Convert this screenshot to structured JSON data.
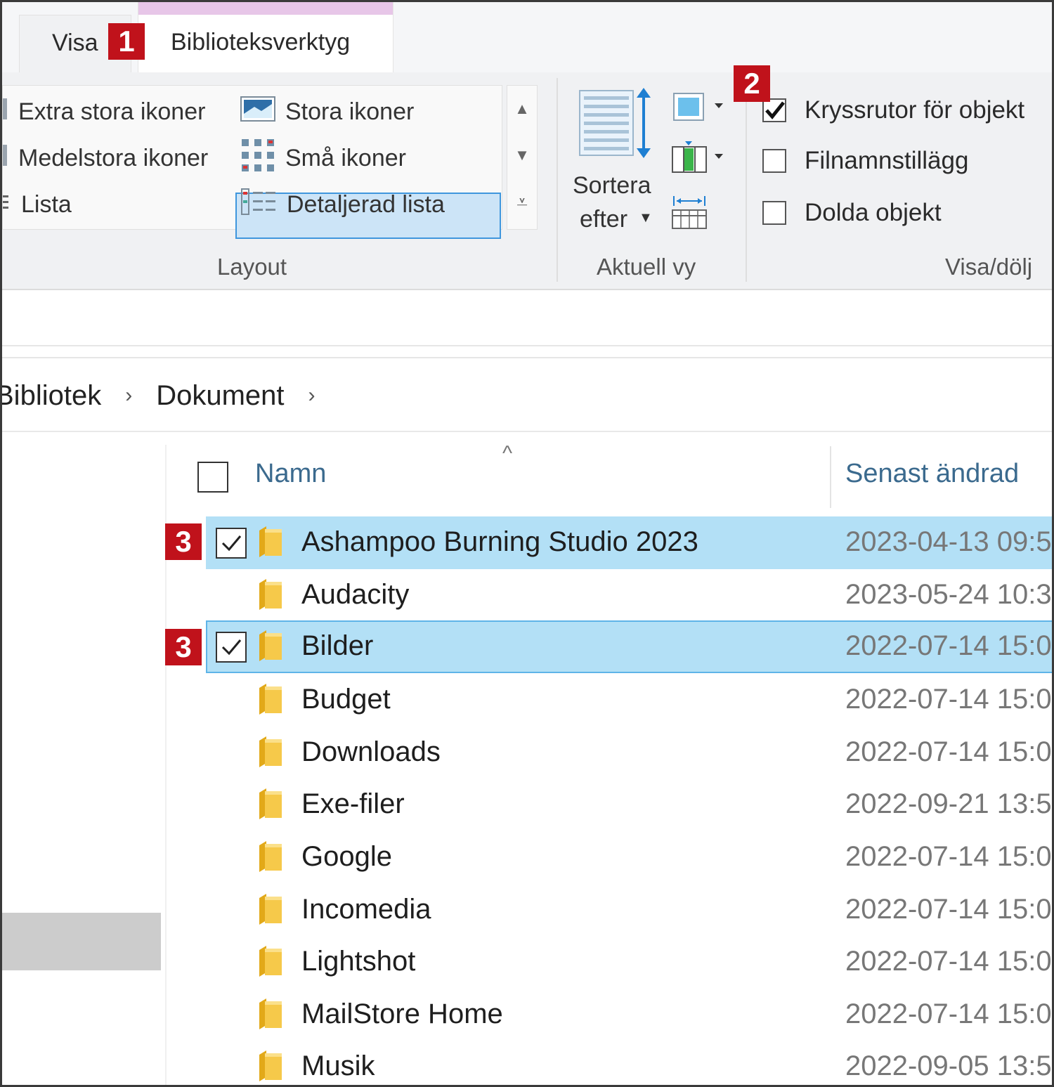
{
  "tabs": {
    "visa": "Visa",
    "biblioteksverktyg": "Biblioteksverktyg"
  },
  "badges": {
    "one": "1",
    "two": "2",
    "three": "3"
  },
  "layout": {
    "items": {
      "extra_stora": "Extra stora ikoner",
      "stora": "Stora ikoner",
      "medelstora": "Medelstora ikoner",
      "sma": "Små ikoner",
      "lista": "Lista",
      "detaljerad": "Detaljerad lista"
    },
    "selected": "Detaljerad lista",
    "group_label": "Layout"
  },
  "current_view": {
    "sort_line1": "Sortera",
    "sort_line2": "efter",
    "group_label": "Aktuell vy"
  },
  "show_hide": {
    "options": [
      {
        "label": "Kryssrutor för objekt",
        "checked": true
      },
      {
        "label": "Filnamnstillägg",
        "checked": false
      },
      {
        "label": "Dolda objekt",
        "checked": false
      }
    ],
    "group_label": "Visa/dölj"
  },
  "breadcrumb": {
    "items": [
      "Bibliotek",
      "Dokument"
    ],
    "separator": "›"
  },
  "columns": {
    "name": "Namn",
    "modified": "Senast ändrad"
  },
  "files": [
    {
      "name": "Ashampoo Burning Studio 2023",
      "date": "2023-04-13 09:5",
      "selected": true,
      "badge": "3"
    },
    {
      "name": "Audacity",
      "date": "2023-05-24 10:3",
      "selected": false
    },
    {
      "name": "Bilder",
      "date": "2022-07-14 15:0",
      "selected": true,
      "badge": "3"
    },
    {
      "name": "Budget",
      "date": "2022-07-14 15:0",
      "selected": false
    },
    {
      "name": "Downloads",
      "date": "2022-07-14 15:0",
      "selected": false
    },
    {
      "name": "Exe-filer",
      "date": "2022-09-21 13:5",
      "selected": false
    },
    {
      "name": "Google",
      "date": "2022-07-14 15:0",
      "selected": false
    },
    {
      "name": "Incomedia",
      "date": "2022-07-14 15:0",
      "selected": false
    },
    {
      "name": "Lightshot",
      "date": "2022-07-14 15:0",
      "selected": false
    },
    {
      "name": "MailStore Home",
      "date": "2022-07-14 15:0",
      "selected": false
    },
    {
      "name": "Musik",
      "date": "2022-09-05 13:5",
      "selected": false
    }
  ],
  "colors": {
    "accent_selection": "#b3e0f6",
    "badge_red": "#c0121b",
    "column_header": "#3b6a8e",
    "folder_yellow": "#f6c94a"
  }
}
